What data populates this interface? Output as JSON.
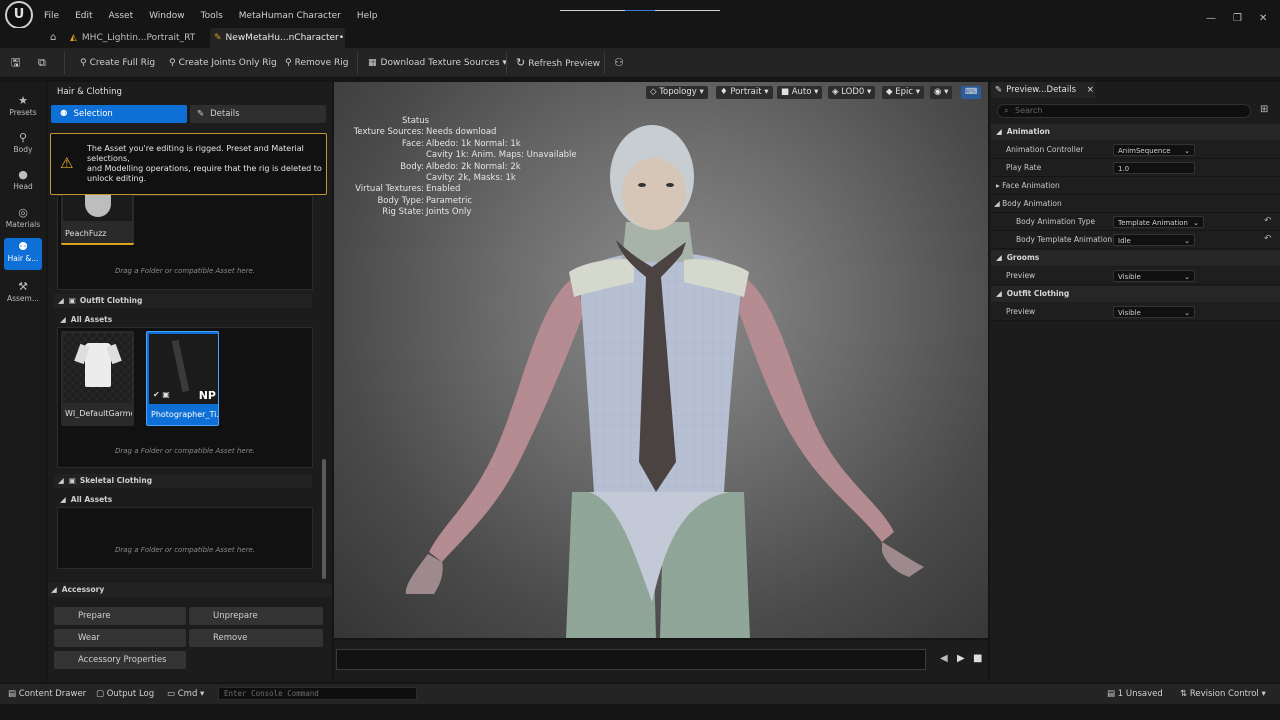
{
  "menu": [
    "File",
    "Edit",
    "Asset",
    "Window",
    "Tools",
    "MetaHuman Character",
    "Help"
  ],
  "tabs": [
    {
      "label": "MHC_Lightin...Portrait_RT"
    },
    {
      "label": "NewMetaHu...nCharacter•",
      "close": "×"
    }
  ],
  "toolbar": {
    "create_full_rig": "Create Full Rig",
    "create_joints_only_rig": "Create Joints Only Rig",
    "remove_rig": "Remove Rig",
    "download_texture_sources": "Download Texture Sources ▾",
    "refresh_preview": "Refresh Preview"
  },
  "nav": [
    {
      "label": "Presets",
      "icon": "star-icon"
    },
    {
      "label": "Body",
      "icon": "body-icon"
    },
    {
      "label": "Head",
      "icon": "head-icon"
    },
    {
      "label": "Materials",
      "icon": "materials-icon"
    },
    {
      "label": "Hair &...",
      "icon": "hair-icon"
    },
    {
      "label": "Assem...",
      "icon": "hammer-icon"
    }
  ],
  "left_panel": {
    "header": "Hair & Clothing",
    "seg_selection": "Selection",
    "seg_details": "Details",
    "warning": "The Asset you're editing is rigged. Preset and Material selections,\nand Modelling operations, require that the rig is deleted to unlock editing.",
    "peachfuzz": "PeachFuzz",
    "drop_hint": "Drag a Folder or compatible Asset here.",
    "outfit_header": "Outfit Clothing",
    "all_assets": "All Assets",
    "tile_default": "WI_DefaultGarment",
    "tile_photo": "Photographer_Ti...",
    "np_badge": "NP",
    "skeletal_header": "Skeletal Clothing",
    "accessory_header": "Accessory",
    "btn_prepare": "Prepare",
    "btn_unprepare": "Unprepare",
    "btn_wear": "Wear",
    "btn_remove": "Remove",
    "btn_props": "Accessory Properties"
  },
  "viewport": {
    "topology": "Topology ▾",
    "portrait": "Portrait ▾",
    "auto": "Auto ▾",
    "lod": "LOD0 ▾",
    "quality": "Epic ▾",
    "eye": "◉ ▾",
    "status_title": "Status",
    "status": [
      {
        "k": "Texture Sources:",
        "v": "Needs download"
      },
      {
        "k": "Face:",
        "v": "Albedo: 1k Normal: 1k"
      },
      {
        "k": "",
        "v": "Cavity 1k: Anim. Maps: Unavailable"
      },
      {
        "k": "Body:",
        "v": "Albedo: 2k Normal: 2k"
      },
      {
        "k": "",
        "v": "Cavity: 2k, Masks: 1k"
      },
      {
        "k": "Virtual Textures:",
        "v": "Enabled"
      },
      {
        "k": "Body Type:",
        "v": "Parametric"
      },
      {
        "k": "Rig State:",
        "v": "Joints Only"
      }
    ]
  },
  "details": {
    "tab": "Preview...Details",
    "close": "×",
    "search_placeholder": "Search",
    "animation": "Animation",
    "anim_controller": "Animation Controller",
    "anim_controller_val": "AnimSequence",
    "play_rate": "Play Rate",
    "play_rate_val": "1.0",
    "face_animation": "Face Animation",
    "body_animation": "Body Animation",
    "body_anim_type": "Body Animation Type",
    "body_anim_type_val": "Template Animation",
    "body_template": "Body Template Animation",
    "body_template_val": "Idle",
    "grooms": "Grooms",
    "preview": "Preview",
    "visible": "Visible",
    "outfit": "Outfit Clothing"
  },
  "bottom": {
    "content_drawer": "Content Drawer",
    "output_log": "Output Log",
    "cmd": "Cmd ▾",
    "console_placeholder": "Enter Console Command",
    "unsaved": "1 Unsaved",
    "revision": "Revision Control ▾"
  }
}
